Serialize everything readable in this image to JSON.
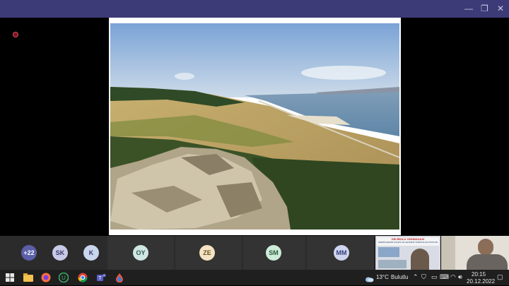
{
  "window": {
    "minimize_glyph": "—",
    "restore_glyph": "❐",
    "close_glyph": "✕"
  },
  "participants": [
    {
      "initials": "+22",
      "bg": "#5b5fa8",
      "fg": "#ffffff"
    },
    {
      "initials": "SK",
      "bg": "#c9cae8",
      "fg": "#3a3a6a"
    },
    {
      "initials": "K",
      "bg": "#c9d6ee",
      "fg": "#3a3a6a"
    },
    {
      "initials": "OY",
      "bg": "#cfe7e3",
      "fg": "#2e5a55"
    },
    {
      "initials": "ZE",
      "bg": "#f3e3c4",
      "fg": "#6b5020"
    },
    {
      "initials": "SM",
      "bg": "#cdecd9",
      "fg": "#2c5a3a"
    },
    {
      "initials": "MM",
      "bg": "#cfd5ef",
      "fg": "#33407a"
    }
  ],
  "shared_video": {
    "banner_line1": "GELİBOLU YARIMADASI",
    "banner_line2": "SEDDÜLBAHİR KALESİ VE ÇEVRESİ TARİHİ ALAN DOSYASI"
  },
  "taskbar": {
    "apps": [
      "windows-start-icon",
      "file-explorer-icon",
      "firefox-icon",
      "upwork-icon",
      "chrome-icon",
      "teams-icon",
      "app-drop-icon"
    ],
    "weather": {
      "temp": "13°C",
      "condition": "Bulutlu"
    },
    "time": "20:15",
    "date": "20.12.2022"
  }
}
